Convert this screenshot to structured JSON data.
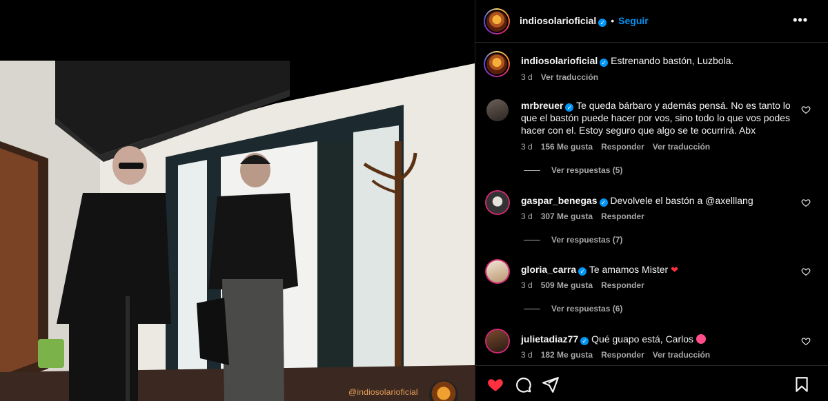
{
  "post": {
    "username": "indiosolarioficial",
    "follow_label": "Seguir",
    "watermark": "@indiosolarioficial"
  },
  "caption": {
    "username": "indiosolarioficial",
    "text": "Estrenando bastón, Luzbola.",
    "time": "3 d",
    "translate": "Ver traducción"
  },
  "comments": [
    {
      "username": "mrbreuer",
      "text": "Te queda bárbaro y además pensá. No es tanto lo que el bastón puede hacer por vos, sino todo lo que vos podes hacer con el. Estoy seguro que algo se te ocurrirá. Abx",
      "time": "3 d",
      "likes": "156 Me gusta",
      "reply": "Responder",
      "translate": "Ver traducción",
      "view_replies": "Ver respuestas (5)"
    },
    {
      "username": "gaspar_benegas",
      "text": "Devolvele el bastón a @axelllang",
      "time": "3 d",
      "likes": "307 Me gusta",
      "reply": "Responder",
      "view_replies": "Ver respuestas (7)"
    },
    {
      "username": "gloria_carra",
      "text": "Te amamos Mister",
      "time": "3 d",
      "likes": "509 Me gusta",
      "reply": "Responder",
      "view_replies": "Ver respuestas (6)"
    },
    {
      "username": "julietadiaz77",
      "text": "Qué guapo está, Carlos",
      "time": "3 d",
      "likes": "182 Me gusta",
      "reply": "Responder",
      "translate": "Ver traducción"
    }
  ],
  "icons": [
    "more-options-icon",
    "verified-icon",
    "heart-icon",
    "comment-icon",
    "share-icon",
    "save-icon"
  ],
  "colors": {
    "accent": "#0095f6",
    "like": "#ff3040",
    "muted": "#a8a8a8",
    "background": "#000000"
  }
}
